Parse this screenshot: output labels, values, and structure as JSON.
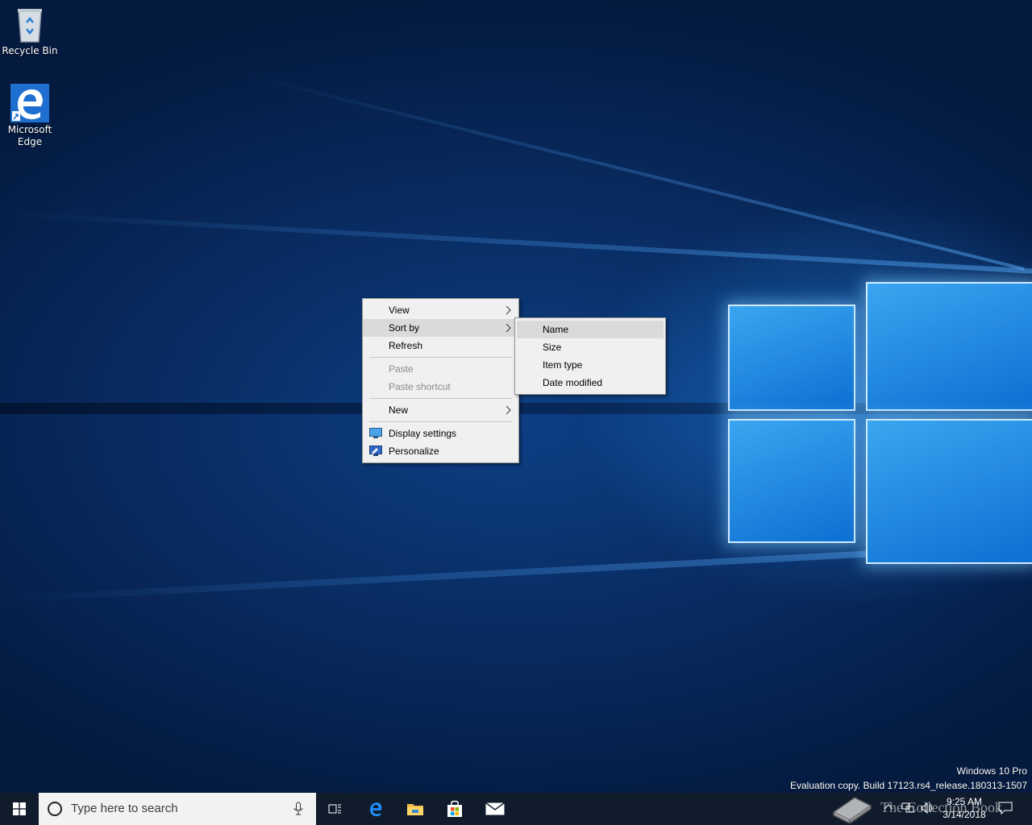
{
  "desktop": {
    "icons": [
      {
        "label": "Recycle Bin"
      },
      {
        "label": "Microsoft Edge"
      }
    ],
    "watermark": {
      "line1": "Windows 10 Pro",
      "line2": "Evaluation copy. Build 17123.rs4_release.180313-1507"
    }
  },
  "context_menu": {
    "items": [
      {
        "label": "View",
        "submenu": true,
        "enabled": true
      },
      {
        "label": "Sort by",
        "submenu": true,
        "enabled": true,
        "highlighted": true
      },
      {
        "label": "Refresh",
        "enabled": true
      },
      {
        "label": "Paste",
        "enabled": false
      },
      {
        "label": "Paste shortcut",
        "enabled": false
      },
      {
        "label": "New",
        "submenu": true,
        "enabled": true
      },
      {
        "label": "Display settings",
        "icon": "display-icon",
        "enabled": true
      },
      {
        "label": "Personalize",
        "icon": "personalize-icon",
        "enabled": true
      }
    ]
  },
  "sort_submenu": {
    "items": [
      {
        "label": "Name",
        "highlighted": true
      },
      {
        "label": "Size"
      },
      {
        "label": "Item type"
      },
      {
        "label": "Date modified"
      }
    ]
  },
  "taskbar": {
    "search_placeholder": "Type here to search",
    "pinned": [
      "task-view-icon",
      "edge-icon",
      "file-explorer-icon",
      "store-icon",
      "mail-icon"
    ],
    "time": "9:25 AM",
    "date": "3/14/2018",
    "brand": "The Collection Book"
  },
  "colors": {
    "taskbar_bg": "#101c2c",
    "menu_bg": "#f0f0f0",
    "highlight": "#dadada",
    "accent": "#0078d7"
  }
}
